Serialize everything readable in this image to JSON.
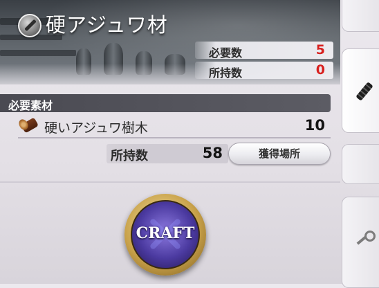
{
  "item": {
    "name": "硬アジュワ材",
    "icon": "hard-wood-icon",
    "required_label": "必要数",
    "required_value": "5",
    "owned_label": "所持数",
    "owned_value": "0"
  },
  "materials": {
    "section_title": "必要素材",
    "entries": [
      {
        "name": "硬いアジュワ樹木",
        "icon": "log-icon",
        "required": "10",
        "owned_label": "所持数",
        "owned": "58",
        "location_button": "獲得場所"
      }
    ]
  },
  "craft": {
    "label": "CRAFT"
  },
  "colors": {
    "highlight_red": "#d8201e",
    "craft_gold": "#c9a24a",
    "craft_purple": "#4b3aa0"
  }
}
